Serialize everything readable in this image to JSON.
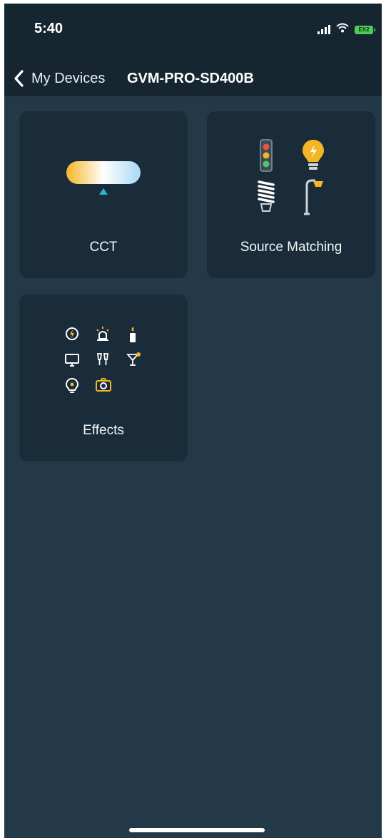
{
  "status_bar": {
    "time": "5:40",
    "battery": "EX2"
  },
  "nav": {
    "back_label": "My Devices",
    "title": "GVM-PRO-SD400B"
  },
  "tiles": [
    {
      "label": "CCT",
      "icon": "cct-gradient-icon"
    },
    {
      "label": "Source Matching",
      "icon": "source-matching-icon"
    },
    {
      "label": "Effects",
      "icon": "effects-grid-icon"
    }
  ],
  "colors": {
    "background": "#243947",
    "header": "#162631",
    "tile": "#1a2c39",
    "accent": "#f5b626",
    "indicator": "#2fb3d6"
  }
}
